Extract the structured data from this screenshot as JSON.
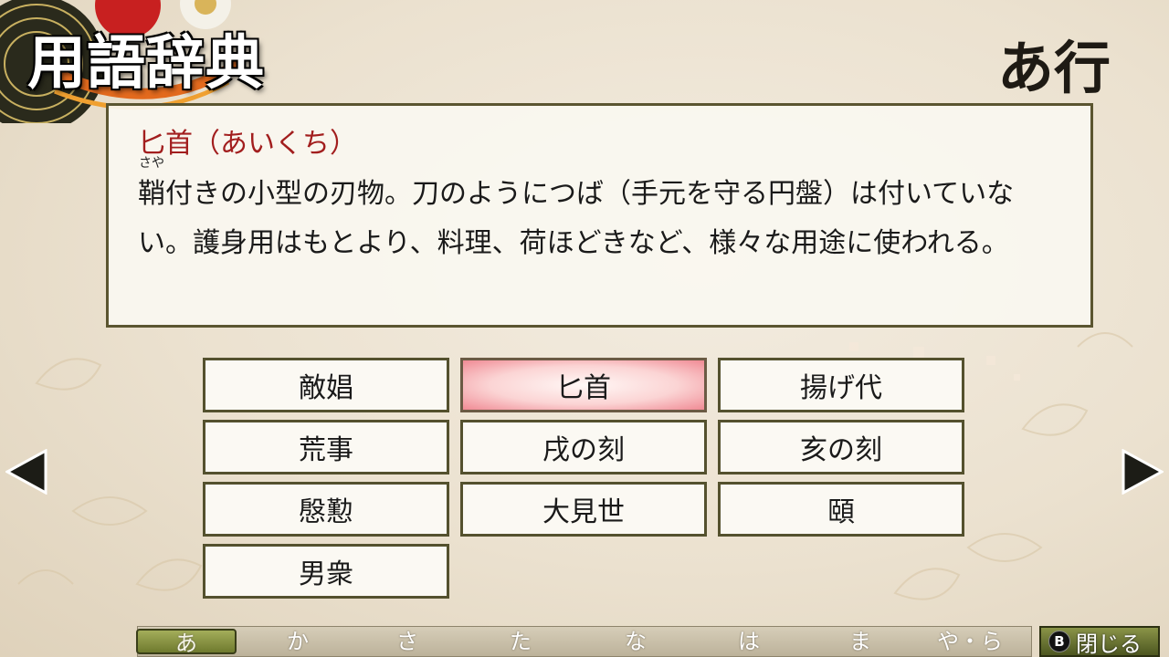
{
  "header": {
    "title": "用語辞典",
    "section": "あ行"
  },
  "entry": {
    "term": "匕首（あいくち）",
    "ruby_base": "鞘",
    "ruby_reading": "さや",
    "body": "付きの小型の刃物。刀のようにつば（手元を守る円盤）は付いていない。護身用はもとより、料理、荷ほどきなど、様々な用途に使われる。"
  },
  "terms": [
    "敵娼",
    "匕首",
    "揚げ代",
    "荒事",
    "戌の刻",
    "亥の刻",
    "慇懃",
    "大見世",
    "頤",
    "男衆"
  ],
  "selected_term": "匕首",
  "kana_tabs": [
    "あ",
    "か",
    "さ",
    "た",
    "な",
    "は",
    "ま",
    "や・ら"
  ],
  "active_kana": "あ",
  "close": {
    "badge": "B",
    "label": "閉じる"
  },
  "icons": {
    "prev": "triangle-left-icon",
    "next": "triangle-right-icon"
  },
  "colors": {
    "term_title": "#a21e1e",
    "frame": "#5b5530",
    "selected": "#f08a94",
    "active_tab": "#8a9448"
  }
}
